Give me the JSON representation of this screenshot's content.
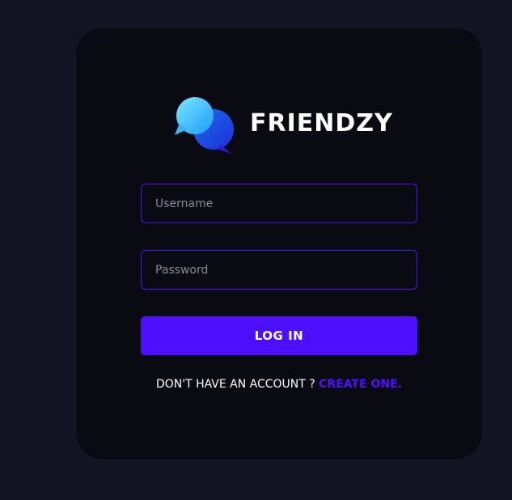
{
  "brand": {
    "name": "FRIENDZY",
    "logo_icon": "chat-bubbles-icon"
  },
  "form": {
    "username": {
      "placeholder": "Username",
      "value": ""
    },
    "password": {
      "placeholder": "Password",
      "value": ""
    },
    "login_label": "LOG IN",
    "signup_prompt": "DON'T HAVE AN ACCOUNT ? ",
    "signup_link": "CREATE ONE."
  },
  "colors": {
    "background": "#131324",
    "card": "#0a0b12",
    "accent": "#4e0eff",
    "text": "#ffffff"
  }
}
